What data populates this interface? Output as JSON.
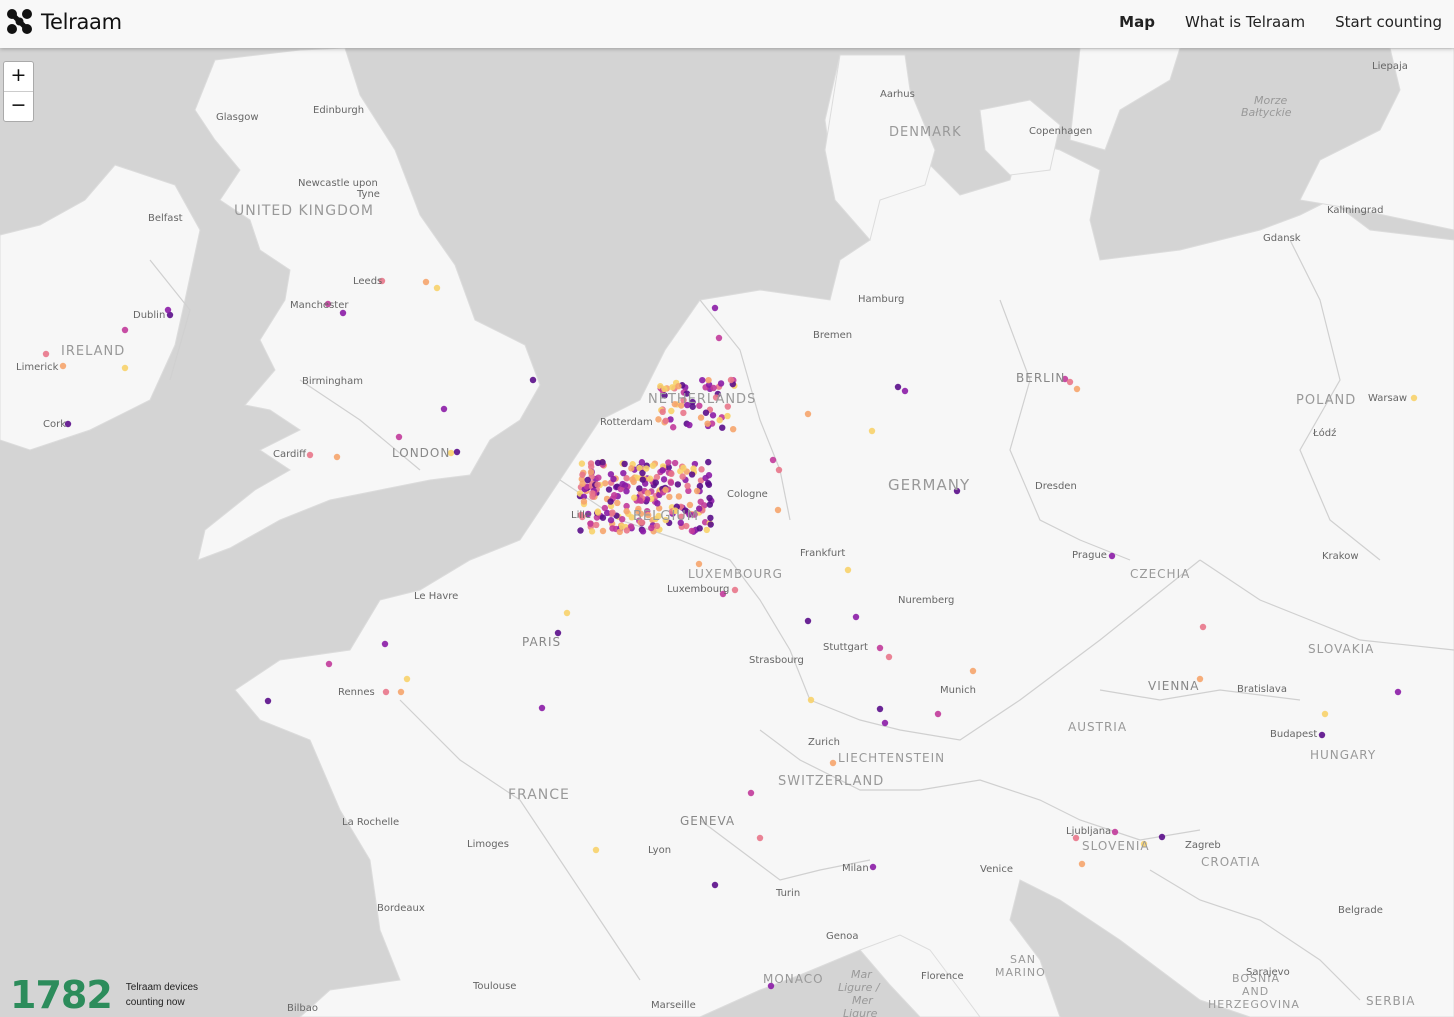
{
  "app": {
    "logo_text": "Telraam"
  },
  "nav": [
    {
      "label": "Map",
      "active": true
    },
    {
      "label": "What is Telraam"
    },
    {
      "label": "Start counting"
    }
  ],
  "zoom": {
    "in_label": "+",
    "out_label": "−"
  },
  "counter": {
    "value": "1782",
    "label_line1": "Telraam devices",
    "label_line2": "counting now",
    "color": "#2c8c5b"
  },
  "map": {
    "countries": [
      "UNITED KINGDOM",
      "IRELAND",
      "NETHERLANDS",
      "BELGIUM",
      "LUXEMBOURG",
      "GERMANY",
      "DENMARK",
      "POLAND",
      "CZECHIA",
      "SLOVAKIA",
      "AUSTRIA",
      "HUNGARY",
      "SWITZERLAND",
      "LIECHTENSTEIN",
      "FRANCE",
      "SLOVENIA",
      "CROATIA",
      "BOSNIA",
      "AND",
      "HERZEGOVINA",
      "SERBIA",
      "SAN",
      "MARINO",
      "MONACO"
    ],
    "cities": [
      "Glasgow",
      "Edinburgh",
      "Newcastle upon",
      "Tyne",
      "Belfast",
      "Leeds",
      "Manchester",
      "Dublin",
      "Limerick",
      "Birmingham",
      "Cork",
      "Cardiff",
      "LONDON",
      "Aarhus",
      "Copenhagen",
      "Liepaja",
      "Kaliningrad",
      "Gdansk",
      "Hamburg",
      "Bremen",
      "BERLIN",
      "Warsaw",
      "Łódź",
      "Rotterdam",
      "Lille",
      "Cologne",
      "Dresden",
      "Prague",
      "Krakow",
      "Frankfurt",
      "Luxembourg",
      "Nuremberg",
      "Le Havre",
      "PARIS",
      "Strasbourg",
      "Stuttgart",
      "Rennes",
      "Munich",
      "VIENNA",
      "Bratislava",
      "Budapest",
      "Zurich",
      "La Rochelle",
      "GENEVA",
      "Limoges",
      "Lyon",
      "Ljubljana",
      "Zagreb",
      "Milan",
      "Venice",
      "Turin",
      "Bordeaux",
      "Genoa",
      "Florence",
      "Sarajevo",
      "Belgrade",
      "Toulouse",
      "Marseille",
      "Bilbao"
    ],
    "water": [
      "Morze",
      "Bałtyckie",
      "Mar",
      "Ligure /",
      "Mer",
      "Ligure"
    ],
    "colors": {
      "land": "#f7f7f7",
      "sea": "#d4d4d4",
      "border": "#d6d6d6"
    },
    "device_palette": [
      "#5a0d8a",
      "#8b1ca6",
      "#c13a9a",
      "#e8768a",
      "#f5a46b",
      "#f7d26a"
    ]
  }
}
